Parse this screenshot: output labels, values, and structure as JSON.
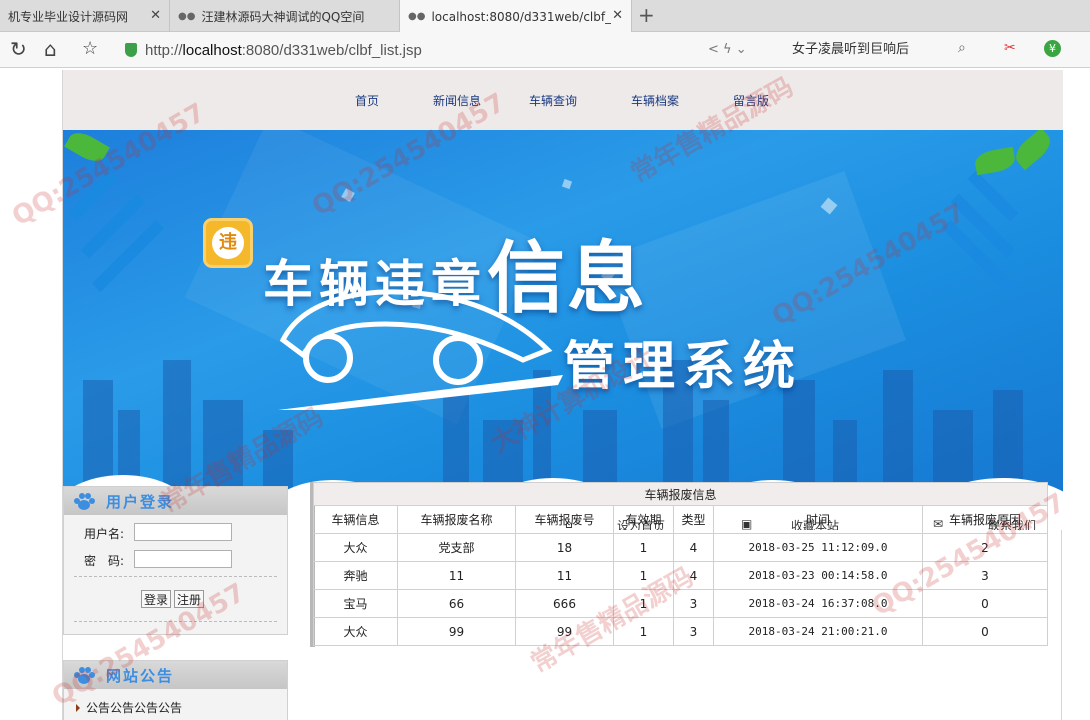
{
  "browser": {
    "tabs": [
      {
        "label": "机专业毕业设计源码网",
        "active": false
      },
      {
        "label": "汪建林源码大神调试的QQ空间",
        "active": false
      },
      {
        "label": "localhost:8080/d331web/clbf_",
        "active": true
      }
    ],
    "url_prefix": "http://",
    "url_host": "localhost",
    "url_rest": ":8080/d331web/clbf_list.jsp",
    "search_text": "女子凌晨听到巨响后"
  },
  "nav": {
    "items": [
      "首页",
      "新闻信息",
      "车辆查询",
      "车辆档案",
      "留言版"
    ]
  },
  "banner": {
    "title_part1": "车辆违章",
    "title_part2": "信息",
    "subtitle": "管理系统",
    "logo_glyph": "违"
  },
  "quicklinks": {
    "home": "设为首页",
    "favorite": "收藏本站",
    "contact": "联系我们"
  },
  "login": {
    "title": "用户登录",
    "username_label": "用户名:",
    "password_label": "密　码:",
    "login_button": "登录",
    "register_button": "注册"
  },
  "notice": {
    "title": "网站公告",
    "items": [
      "公告公告公告公告"
    ]
  },
  "table": {
    "caption": "车辆报废信息",
    "headers": [
      "车辆信息",
      "车辆报废名称",
      "车辆报废号",
      "有效期",
      "类型",
      "时间",
      "车辆报废原因"
    ],
    "rows": [
      [
        "大众",
        "党支部",
        "18",
        "1",
        "4",
        "2018-03-25 11:12:09.0",
        "2"
      ],
      [
        "奔驰",
        "11",
        "11",
        "1",
        "4",
        "2018-03-23 00:14:58.0",
        "3"
      ],
      [
        "宝马",
        "66",
        "666",
        "1",
        "3",
        "2018-03-24 16:37:08.0",
        "0"
      ],
      [
        "大众",
        "99",
        "99",
        "1",
        "3",
        "2018-03-24 21:00:21.0",
        "0"
      ]
    ]
  },
  "watermarks": [
    "QQ:254540457",
    "常年售精品源码",
    "大神计算机设计"
  ]
}
